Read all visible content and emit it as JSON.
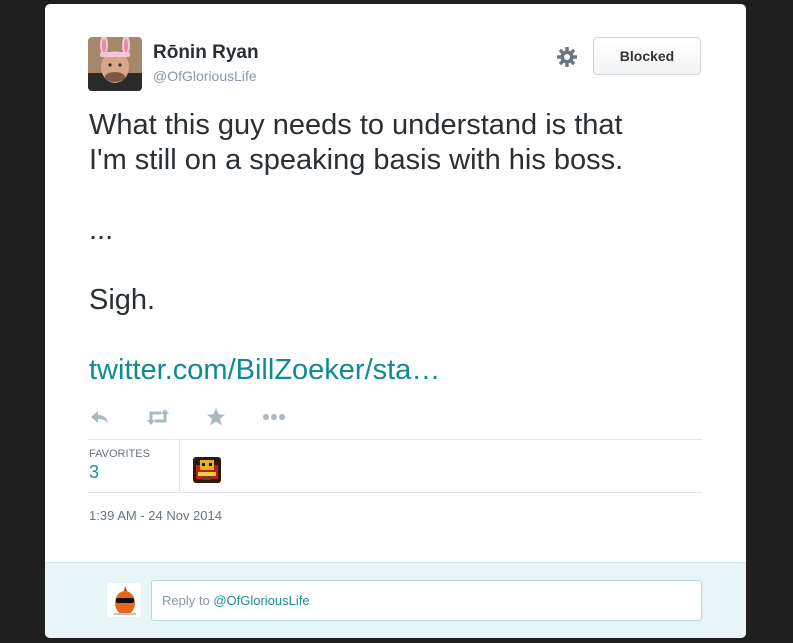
{
  "tweet": {
    "author": {
      "display_name": "Rōnin Ryan",
      "handle": "@OfGloriousLife"
    },
    "follow_button_label": "Blocked",
    "text_lines": [
      "What this guy needs to understand is that",
      "I'm still on a speaking basis with his boss."
    ],
    "ellipsis_line": "...",
    "sigh_line": "Sigh.",
    "link_text": "twitter.com/BillZoeker/sta…",
    "actions": [
      "reply-icon",
      "retweet-icon",
      "favorite-icon",
      "more-icon"
    ],
    "stats": {
      "favorites_label": "FAVORITES",
      "favorites_count": "3"
    },
    "timestamp": "1:39 AM - 24 Nov 2014"
  },
  "reply": {
    "prefix": "Reply to ",
    "mention": "@OfGloriousLife"
  },
  "colors": {
    "link": "#0e8c92",
    "reply_background": "#e8f5f6",
    "page_background": "#1f1f1f"
  }
}
